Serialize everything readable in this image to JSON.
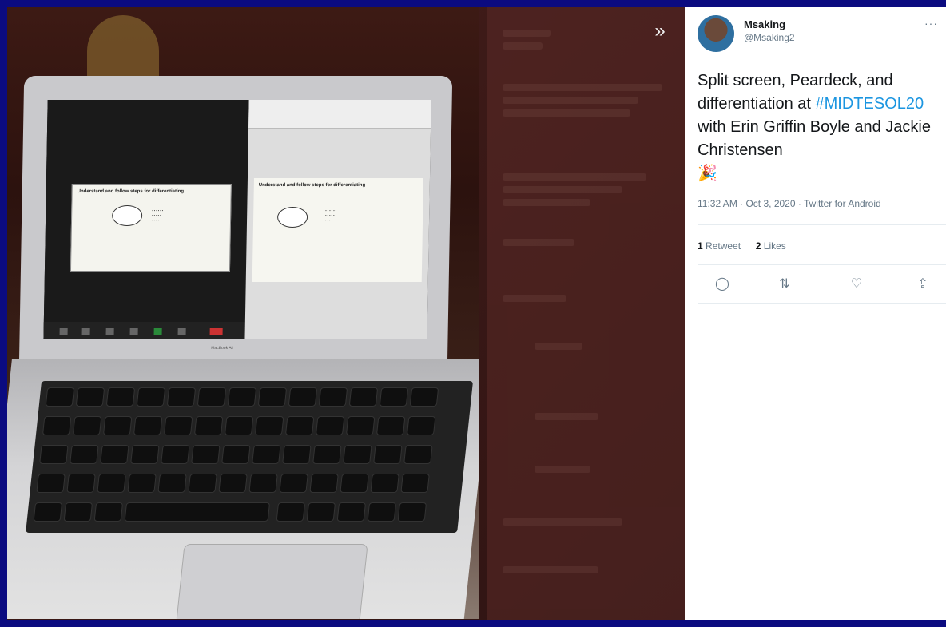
{
  "tweet": {
    "display_name": "Msaking",
    "handle": "@Msaking2",
    "more_label": "···",
    "text_part1": "Split screen, Peardeck, and differentiation at ",
    "hashtag": "#MIDTESOL20",
    "text_part2": " with Erin Griffin Boyle and Jackie Christensen",
    "emoji": "party-popper-icon",
    "emoji_glyph": "🎉",
    "timestamp": "11:32 AM · Oct 3, 2020 · Twitter for Android",
    "retweet_count": "1",
    "retweet_label": "Retweet",
    "like_count": "2",
    "like_label": "Likes"
  },
  "photo": {
    "slide_title": "Understand and follow steps for differentiating",
    "bubble_text": "What is the Content?",
    "laptop_brand": "MacBook Air"
  },
  "icons": {
    "expand": "»",
    "reply": "◯",
    "retweet": "⇅",
    "like": "♡",
    "share": "⇪"
  },
  "colors": {
    "frame": "#0b0b80",
    "hashtag": "#1b95e0",
    "text": "#14171a",
    "muted": "#657786"
  }
}
